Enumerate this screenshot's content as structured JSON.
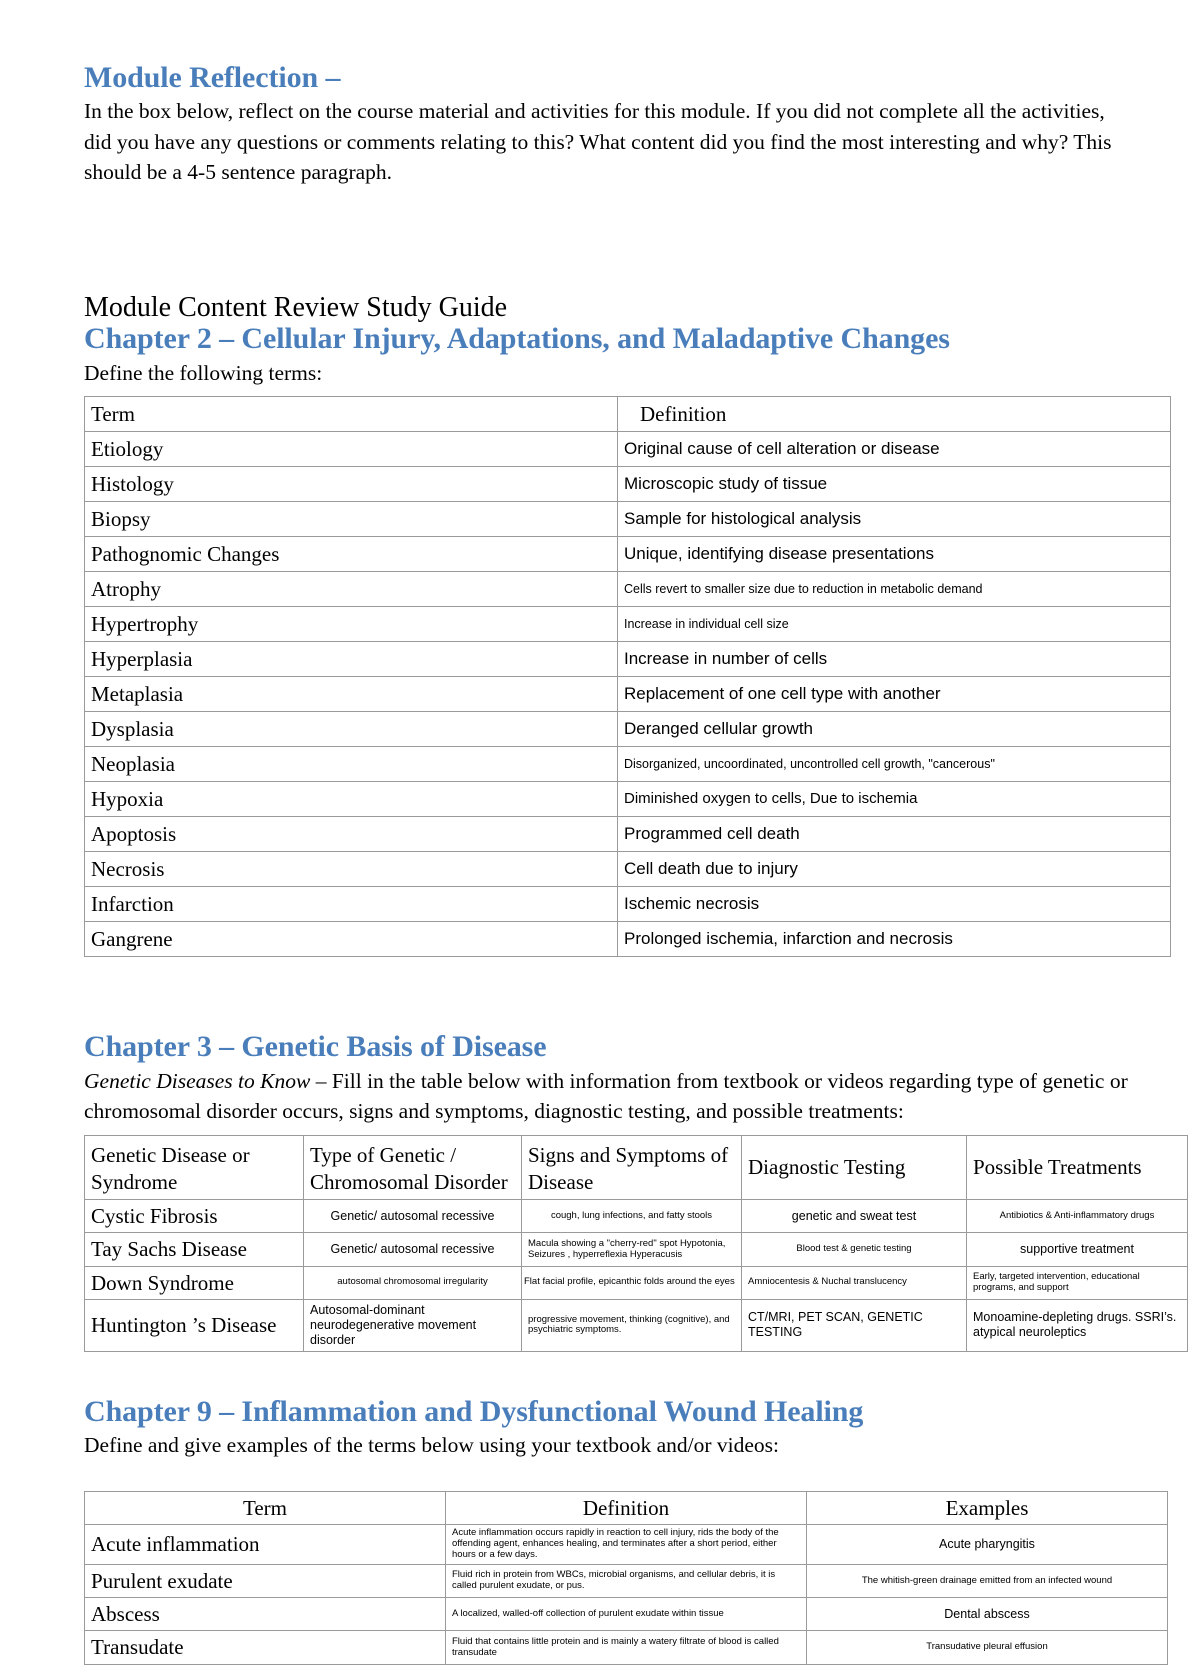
{
  "document": {
    "reflection": {
      "heading": "Module Reflection –",
      "paragraph": "In the box below, reflect on the course material and activities for this module. If you did not complete all the activities, did you have any questions or comments relating to this? What content did you find the most interesting and why? This should be a 4-5 sentence paragraph."
    },
    "study_guide_title": "Module Content Review Study Guide",
    "chapter2": {
      "heading": "Chapter 2 – Cellular Injury, Adaptations, and Maladaptive Changes",
      "instruction": "Define the following terms:",
      "table": {
        "headers": [
          "Term",
          "Definition"
        ],
        "rows": [
          [
            "Etiology",
            "Original cause of cell alteration or disease"
          ],
          [
            "Histology",
            "Microscopic study of tissue"
          ],
          [
            "Biopsy",
            "Sample for histological analysis"
          ],
          [
            "Pathognomic Changes",
            "Unique, identifying disease presentations"
          ],
          [
            "Atrophy",
            "Cells revert to smaller size due to reduction in metabolic demand"
          ],
          [
            "Hypertrophy",
            "Increase in individual cell size"
          ],
          [
            "Hyperplasia",
            "Increase in number of cells"
          ],
          [
            "Metaplasia",
            "Replacement of one cell type with another"
          ],
          [
            "Dysplasia",
            "Deranged cellular growth"
          ],
          [
            "Neoplasia",
            "Disorganized, uncoordinated, uncontrolled cell growth, \"cancerous\""
          ],
          [
            "Hypoxia",
            "Diminished oxygen to cells, Due to ischemia"
          ],
          [
            "Apoptosis",
            "Programmed cell death"
          ],
          [
            "Necrosis",
            "Cell death due to injury"
          ],
          [
            "Infarction",
            "Ischemic necrosis"
          ],
          [
            "Gangrene",
            "Prolonged ischemia, infarction and necrosis"
          ]
        ]
      }
    },
    "chapter3": {
      "heading": "Chapter 3 – Genetic Basis of Disease",
      "instruction_italic": "Genetic Diseases to Know",
      "instruction_rest": " – Fill in the table below with information from textbook or videos regarding type of genetic or chromosomal disorder occurs, signs and symptoms, diagnostic testing, and possible treatments:",
      "table": {
        "headers": [
          "Genetic Disease or Syndrome",
          "Type of Genetic / Chromosomal Disorder",
          "Signs and Symptoms of Disease",
          "Diagnostic Testing",
          "Possible Treatments"
        ],
        "rows": [
          {
            "disease": "Cystic Fibrosis",
            "type": "Genetic/ autosomal recessive",
            "signs": "cough, lung infections, and fatty stools",
            "diagnostic": "genetic and sweat test",
            "treatments": "Antibiotics & Anti-inflammatory drugs"
          },
          {
            "disease": "Tay Sachs Disease",
            "type": "Genetic/ autosomal recessive",
            "signs": "Macula showing a \"cherry-red\" spot Hypotonia, Seizures , hyperreflexia Hyperacusis",
            "diagnostic": "Blood test & genetic testing",
            "treatments": "supportive treatment"
          },
          {
            "disease": "Down Syndrome",
            "type": "autosomal chromosomal irregularity",
            "signs": "Flat facial profile, epicanthic folds around the eyes",
            "diagnostic": "Amniocentesis & Nuchal translucency",
            "treatments": "Early, targeted intervention, educational programs, and support"
          },
          {
            "disease": "Huntington ’s Disease",
            "type": "Autosomal-dominant neurodegenerative movement disorder",
            "signs": "progressive movement, thinking (cognitive), and psychiatric symptoms.",
            "diagnostic": "CT/MRI, PET SCAN, GENETIC TESTING",
            "treatments": "Monoamine-depleting drugs. SSRI’s. atypical neuroleptics"
          }
        ]
      }
    },
    "chapter9": {
      "heading": "Chapter 9 – Inflammation and Dysfunctional Wound Healing",
      "instruction": "Define and give examples of the terms below using your textbook and/or videos:",
      "table": {
        "headers": [
          "Term",
          "Definition",
          "Examples"
        ],
        "rows": [
          {
            "term": "Acute inflammation",
            "definition": "Acute inflammation occurs rapidly in reaction to cell injury, rids the body of the offending agent, enhances healing, and terminates after a short period, either hours or a few days.",
            "example": "Acute pharyngitis"
          },
          {
            "term": "Purulent exudate",
            "definition": "Fluid rich in protein from WBCs, microbial organisms, and cellular debris, it is called purulent exudate, or pus.",
            "example": "The whitish-green drainage emitted from an infected wound"
          },
          {
            "term": "Abscess",
            "definition": "A localized, walled-off collection of purulent exudate within tissue",
            "example": "Dental abscess"
          },
          {
            "term": "Transudate",
            "definition": "Fluid that contains little protein and is mainly a watery filtrate of blood is called transudate",
            "example": "Transudative pleural effusion"
          }
        ]
      }
    },
    "colors": {
      "heading_blue": "#4a7ebb",
      "text_black": "#000000",
      "table_border": "#9a9a9a"
    }
  }
}
